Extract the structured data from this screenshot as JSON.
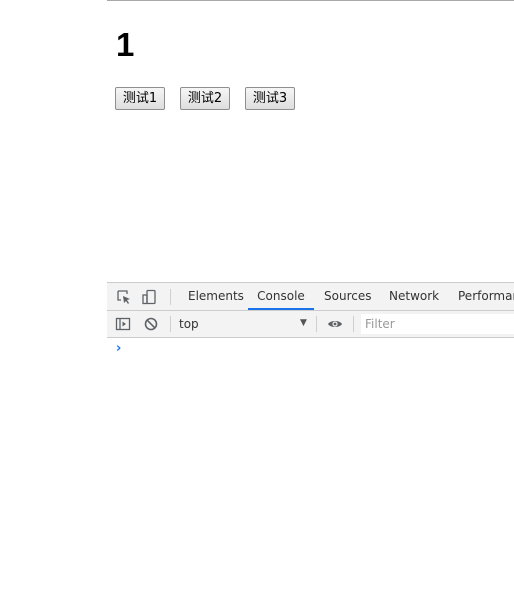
{
  "page": {
    "heading": "1",
    "buttons": [
      "测试1",
      "测试2",
      "测试3"
    ]
  },
  "devtools": {
    "tabs": [
      "Elements",
      "Console",
      "Sources",
      "Network",
      "Performan"
    ],
    "active_tab": "Console",
    "context": "top",
    "filter_placeholder": "Filter",
    "prompt": "›",
    "icons": [
      "inspect-element-icon",
      "device-toolbar-icon",
      "sidebar-toggle-icon",
      "clear-console-icon",
      "eye-icon"
    ],
    "accent_color": "#1a73e8"
  }
}
